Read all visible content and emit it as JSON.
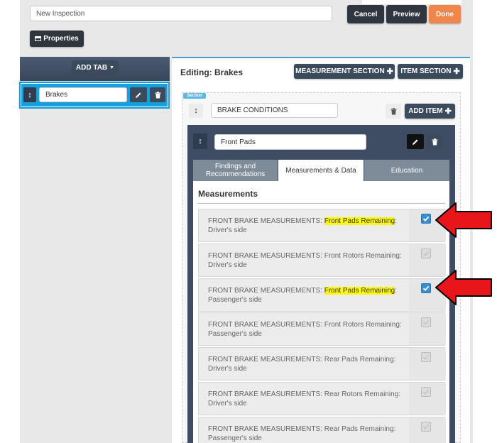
{
  "header": {
    "inspection_name": "New Inspection",
    "cancel_label": "Cancel",
    "preview_label": "Preview",
    "done_label": "Done",
    "properties_label": "Properties"
  },
  "sidebar": {
    "add_tab_label": "ADD TAB",
    "tabs": [
      {
        "name": "Brakes"
      }
    ]
  },
  "editor": {
    "title": "Editing: Brakes",
    "measurement_section_label": "MEASUREMENT SECTION",
    "item_section_label": "ITEM SECTION",
    "section_tag": "Section",
    "section_name": "BRAKE CONDITIONS",
    "add_item_label": "ADD ITEM",
    "item_name": "Front Pads",
    "tabs": [
      "Findings and Recommendations",
      "Measurements & Data",
      "Education"
    ],
    "active_tab": "Measurements & Data",
    "measurements_heading": "Measurements",
    "measurements": [
      {
        "prefix": "FRONT BRAKE MEASUREMENTS: ",
        "highlight": "Front Pads Remaining",
        "suffix": ":",
        "line2": "Driver's side",
        "checked": true
      },
      {
        "prefix": "FRONT BRAKE MEASUREMENTS: Front Rotors Remaining:",
        "highlight": "",
        "suffix": "",
        "line2": "Driver's side",
        "checked": false
      },
      {
        "prefix": "FRONT BRAKE MEASUREMENTS: ",
        "highlight": "Front Pads Remaining",
        "suffix": ":",
        "line2": "Passenger's side",
        "checked": true
      },
      {
        "prefix": "FRONT BRAKE MEASUREMENTS: Front Rotors Remaining:",
        "highlight": "",
        "suffix": "",
        "line2": "Passenger's side",
        "checked": false
      },
      {
        "prefix": "FRONT BRAKE MEASUREMENTS: Rear Pads Remaining:",
        "highlight": "",
        "suffix": "",
        "line2": "Driver's side",
        "checked": false
      },
      {
        "prefix": "FRONT BRAKE MEASUREMENTS: Rear Rotors Remaining:",
        "highlight": "",
        "suffix": "",
        "line2": "Driver's side",
        "checked": false
      },
      {
        "prefix": "FRONT BRAKE MEASUREMENTS: Rear Pads Remaining:",
        "highlight": "",
        "suffix": "",
        "line2": "Passenger's side",
        "checked": false
      }
    ]
  },
  "colors": {
    "accent_blue": "#1a9ad6",
    "highlight": "#ffff00",
    "arrow_red": "#e8161b",
    "done_orange": "#f0874a"
  }
}
